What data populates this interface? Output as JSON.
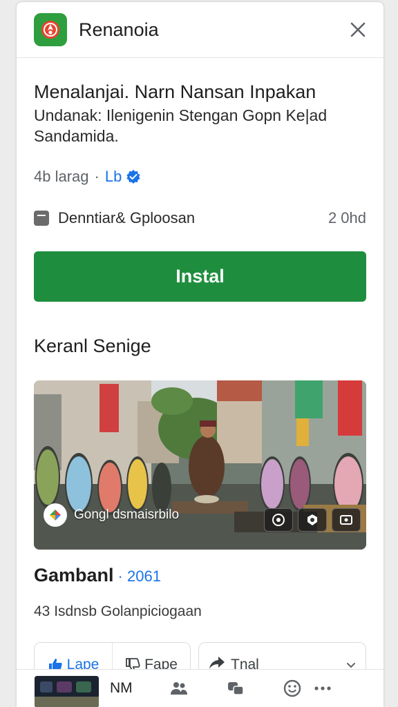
{
  "header": {
    "app_name": "Renanoia",
    "icon": "app-logo-icon",
    "close_icon": "close-icon"
  },
  "listing": {
    "headline": "Menalanjai. Narn Nansan Inpakan",
    "subline": "Undanak: Ilenigenin Stengan Gopn Ke|ad Sandamida.",
    "meta_count": "4b larag",
    "meta_dot": "·",
    "meta_publisher": "Lb",
    "size_label": "Denntiar& Gploosan",
    "size_value": "2 0hd",
    "install_label": "Instal"
  },
  "gallery": {
    "title": "Keranl Senige",
    "caption": "Gongl dsmaisrbilo",
    "controls": [
      "camera-icon",
      "badge-icon",
      "fullscreen-icon"
    ]
  },
  "reviews": {
    "title": "Gambanl",
    "dot": "·",
    "count": "2061",
    "subtitle": "43 Isdnsb Golanpiciogaan"
  },
  "actions": {
    "like_label": "Lape",
    "dislike_label": "Fape",
    "share_label": "Tnal"
  },
  "bottom_bar": {
    "label": "NM",
    "icons": [
      "people-icon",
      "community-icon",
      "emoji-icon",
      "more-icon"
    ]
  },
  "colors": {
    "accent_green": "#1e8e3e",
    "link_blue": "#1a73e8",
    "icon_green": "#2e9e3e",
    "logo_red": "#e8432e"
  }
}
